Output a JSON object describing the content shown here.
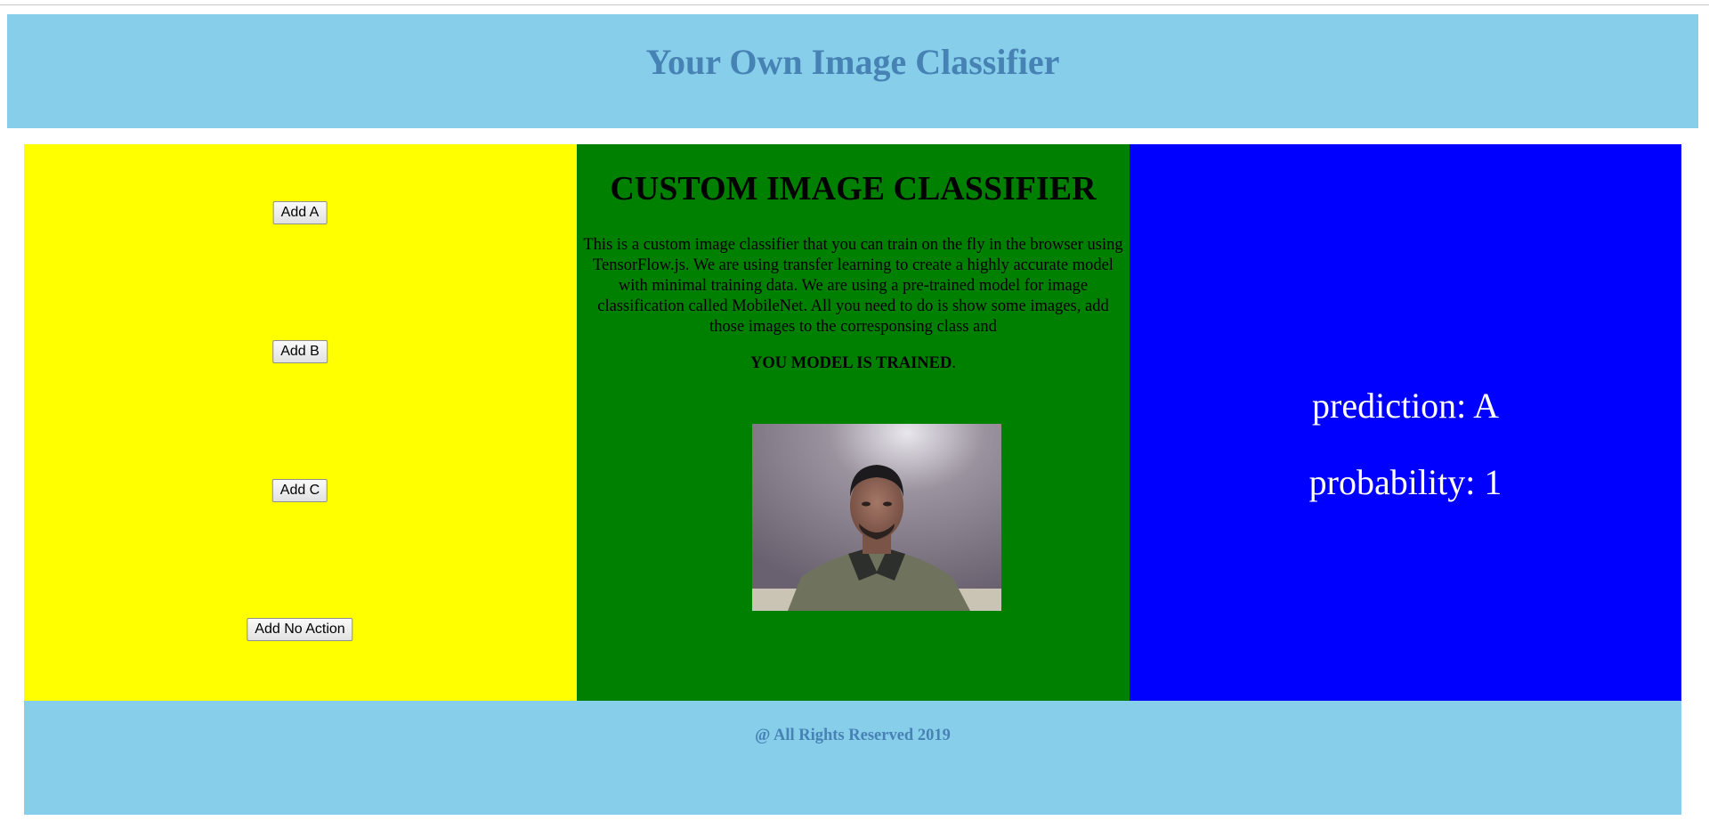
{
  "header": {
    "title": "Your Own Image Classifier"
  },
  "controls": {
    "add_a_label": "Add A",
    "add_b_label": "Add B",
    "add_c_label": "Add C",
    "add_no_action_label": "Add No Action"
  },
  "info": {
    "title": "CUSTOM IMAGE CLASSIFIER",
    "description": "This is a custom image classifier that you can train on the fly in the browser using TensorFlow.js. We are using transfer learning to create a highly accurate model with minimal training data. We are using a pre-trained model for image classification called MobileNet. All you need to do is show some images, add those images to the corresponsing class and",
    "trained_text": "YOU MODEL IS TRAINED",
    "trained_suffix": "."
  },
  "result": {
    "prediction_text": "prediction: A",
    "probability_text": "probability: 1"
  },
  "footer": {
    "text": "@ All Rights Reserved 2019"
  },
  "colors": {
    "header_bg": "#87ceeb",
    "header_text": "#4682b4",
    "left_panel": "#ffff00",
    "mid_panel": "#008000",
    "right_panel": "#0000ff"
  }
}
